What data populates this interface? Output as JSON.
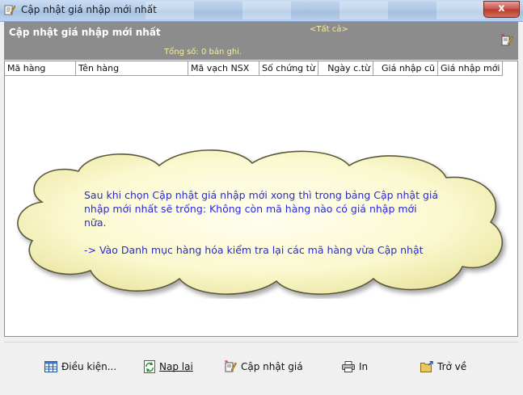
{
  "window": {
    "title": "Cập nhật giá nhập mới nhất",
    "close_label": "x"
  },
  "header": {
    "title": "Cập nhật giá nhập mới nhất",
    "filter": "<Tất cả>",
    "record_count": "Tổng số: 0 bản ghi."
  },
  "grid": {
    "columns": [
      "Mã hàng",
      "Tên hàng",
      "Mã vạch NSX",
      "Số chứng từ",
      "Ngày c.từ",
      "Giá nhập cũ",
      "Giá nhập mới"
    ],
    "rows": []
  },
  "callout": {
    "line1": "Sau khi chọn Cập nhật giá nhập mới xong thì trong bảng Cập nhật giá nhập mới nhất sẽ trống: Không còn mã hàng nào có giá nhập mới nữa.",
    "line2": "-> Vào Danh mục hàng hóa kiểm tra lại các mã hàng vừa Cập nhật"
  },
  "toolbar": {
    "conditions": "Điều kiện...",
    "reload": "Nạp lại",
    "update_price": "Cập nhật giá",
    "print": "In",
    "back": "Trở về"
  },
  "colors": {
    "header_bg": "#8c8c8c",
    "header_accent_text": "#f6ef9c",
    "callout_text": "#2a2ad0",
    "cloud_fill": "#fbf9d0"
  }
}
